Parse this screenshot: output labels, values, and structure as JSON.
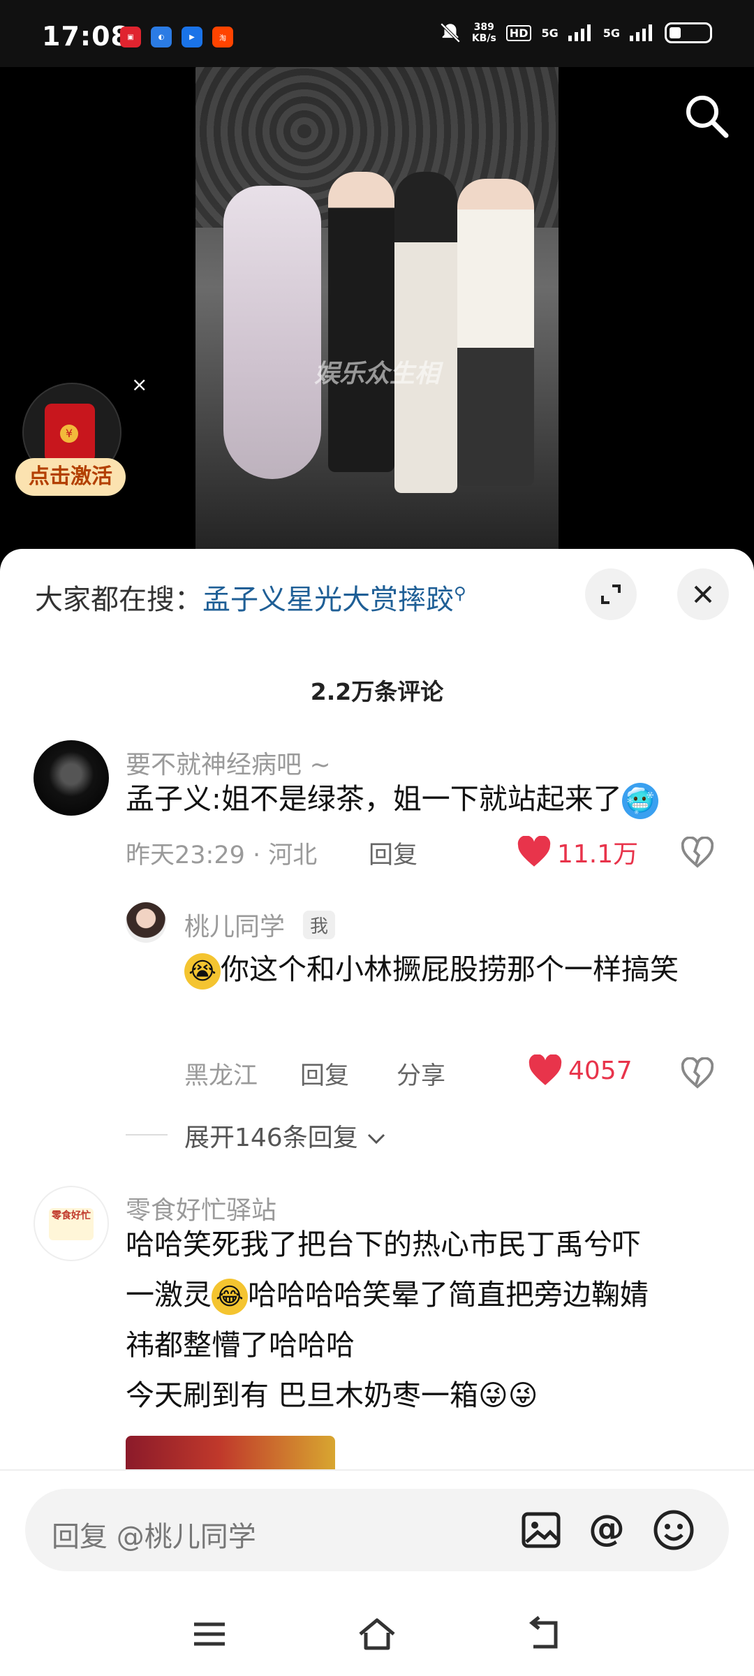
{
  "status_bar": {
    "time": "17:08",
    "net_speed_value": "389",
    "net_speed_unit": "KB/s",
    "hd_label": "HD",
    "sim1": "5G",
    "sim2": "5G"
  },
  "video": {
    "watermark": "娱乐众生相"
  },
  "red_packet": {
    "label": "点击激活",
    "close": "×"
  },
  "sheet": {
    "search_prefix": "大家都在搜：",
    "search_keyword": "孟子义星光大赏摔跤",
    "comment_count": "2.2万条评论"
  },
  "comments": [
    {
      "user": "要不就神经病吧 ~",
      "text": "孟子义:姐不是绿茶，姐一下就站起来了",
      "emoji": "🥶",
      "time_loc": "昨天23:29 · 河北",
      "reply": "回复",
      "likes": "11.1万"
    },
    {
      "user": "桃儿同学",
      "badge": "我",
      "emoji": "😭",
      "text": "你这个和小林撅屁股捞那个一样搞笑",
      "location": "黑龙江",
      "reply": "回复",
      "share": "分享",
      "likes": "4057"
    },
    {
      "expand": "展开146条回复"
    },
    {
      "user": "零食好忙驿站",
      "avatar_text": "零食好忙",
      "line1": "哈哈笑死我了把台下的热心市民丁禹兮吓",
      "line2a": "一激灵",
      "line2_emoji": "😂",
      "line2b": "哈哈哈哈笑晕了简直把旁边鞠婧",
      "line3": "祎都整懵了哈哈哈",
      "line4": "今天刷到有 巴旦木奶枣一箱",
      "line4_emoji": "😜😜"
    }
  ],
  "input": {
    "placeholder": "回复 @桃儿同学"
  },
  "colors": {
    "like_red": "#e8344b",
    "keyword_blue": "#1f5f96"
  }
}
